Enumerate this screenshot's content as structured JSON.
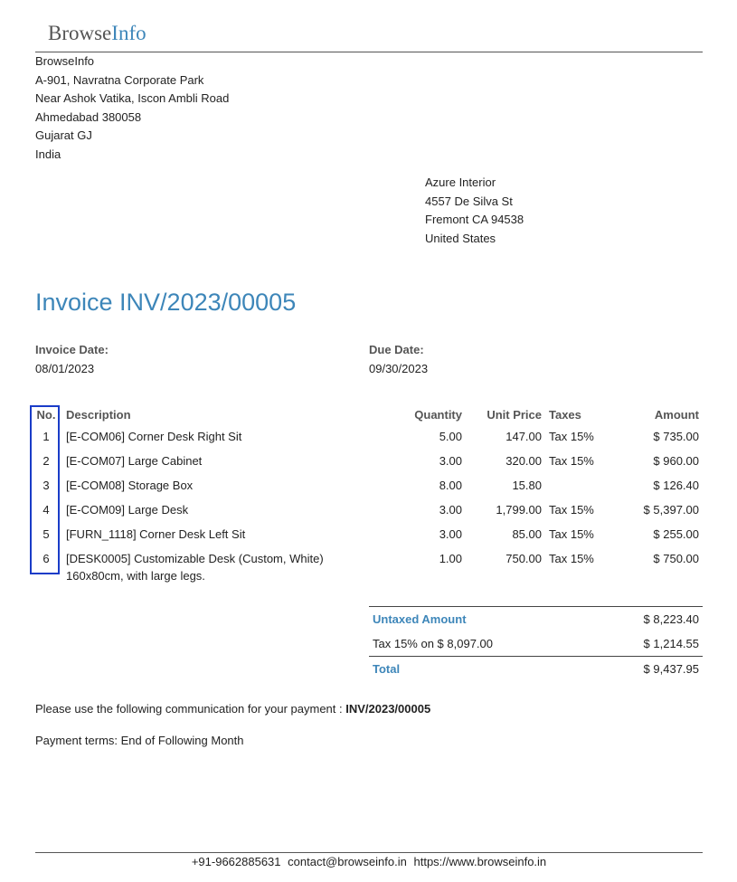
{
  "logo": {
    "part1": "Browse",
    "part2": "Info"
  },
  "company": {
    "name": "BrowseInfo",
    "address_lines": [
      "A-901, Navratna Corporate Park",
      "Near Ashok Vatika, Iscon Ambli Road",
      "Ahmedabad 380058",
      "Gujarat GJ",
      "India"
    ]
  },
  "partner": {
    "name": "Azure Interior",
    "address_lines": [
      "4557 De Silva St",
      "Fremont CA 94538",
      "United States"
    ]
  },
  "invoice": {
    "title": "Invoice INV/2023/00005",
    "date_label": "Invoice Date:",
    "date": "08/01/2023",
    "due_label": "Due Date:",
    "due": "09/30/2023"
  },
  "lines": {
    "headers": {
      "no": "No.",
      "description": "Description",
      "quantity": "Quantity",
      "unit_price": "Unit Price",
      "taxes": "Taxes",
      "amount": "Amount"
    },
    "rows": [
      {
        "no": "1",
        "description": "[E-COM06] Corner Desk Right Sit",
        "sub": "",
        "quantity": "5.00",
        "unit_price": "147.00",
        "taxes": "Tax 15%",
        "amount": "$ 735.00"
      },
      {
        "no": "2",
        "description": "[E-COM07] Large Cabinet",
        "sub": "",
        "quantity": "3.00",
        "unit_price": "320.00",
        "taxes": "Tax 15%",
        "amount": "$ 960.00"
      },
      {
        "no": "3",
        "description": "[E-COM08] Storage Box",
        "sub": "",
        "quantity": "8.00",
        "unit_price": "15.80",
        "taxes": "",
        "amount": "$ 126.40"
      },
      {
        "no": "4",
        "description": "[E-COM09] Large Desk",
        "sub": "",
        "quantity": "3.00",
        "unit_price": "1,799.00",
        "taxes": "Tax 15%",
        "amount": "$ 5,397.00"
      },
      {
        "no": "5",
        "description": "[FURN_1118] Corner Desk Left Sit",
        "sub": "",
        "quantity": "3.00",
        "unit_price": "85.00",
        "taxes": "Tax 15%",
        "amount": "$ 255.00"
      },
      {
        "no": "6",
        "description": "[DESK0005] Customizable Desk (Custom, White)",
        "sub": "160x80cm, with large legs.",
        "quantity": "1.00",
        "unit_price": "750.00",
        "taxes": "Tax 15%",
        "amount": "$ 750.00"
      }
    ]
  },
  "totals": {
    "untaxed_label": "Untaxed Amount",
    "untaxed": "$ 8,223.40",
    "tax_label": "Tax 15% on $ 8,097.00",
    "tax": "$ 1,214.55",
    "total_label": "Total",
    "total": "$ 9,437.95"
  },
  "communication": {
    "text": "Please use the following communication for your payment : ",
    "ref": "INV/2023/00005"
  },
  "terms": "Payment terms: End of Following Month",
  "footer": {
    "phone": "+91-9662885631",
    "email": "contact@browseinfo.in",
    "website": "https://www.browseinfo.in"
  },
  "colors": {
    "accent": "#3d86b9",
    "highlight_box": "#1a3cc8"
  }
}
